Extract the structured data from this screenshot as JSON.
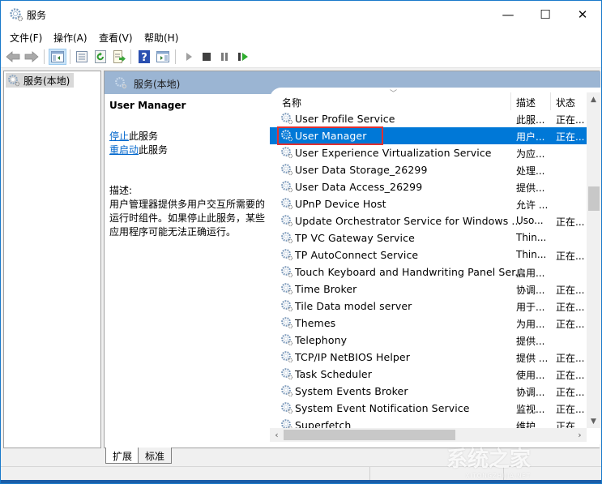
{
  "window": {
    "title": "服务",
    "controls": {
      "minimize": "—",
      "maximize": "☐",
      "close": "✕"
    }
  },
  "menu": [
    {
      "label": "文件(F)"
    },
    {
      "label": "操作(A)"
    },
    {
      "label": "查看(V)"
    },
    {
      "label": "帮助(H)"
    }
  ],
  "toolbar": {
    "buttons": [
      "back-icon",
      "forward-icon",
      "show-hide-console-tree-icon",
      "properties-icon",
      "refresh-icon",
      "export-list-icon",
      "help-icon",
      "show-action-pane-icon",
      "start-service-icon",
      "stop-service-icon",
      "pause-service-icon",
      "restart-service-icon"
    ]
  },
  "tree": {
    "items": [
      {
        "label": "服务(本地)",
        "selected": true
      }
    ]
  },
  "pane": {
    "header": "服务(本地)",
    "detail": {
      "service_name": "User Manager",
      "stop_link": "停止",
      "stop_suffix": "此服务",
      "restart_link": "重启动",
      "restart_suffix": "此服务",
      "desc_label": "描述:",
      "desc_text": "用户管理器提供多用户交互所需要的运行时组件。如果停止此服务，某些应用程序可能无法正确运行。"
    },
    "columns": {
      "name": "名称",
      "description": "描述",
      "status": "状态"
    },
    "services": [
      {
        "name": "User Profile Service",
        "description": "此服...",
        "status": "正在..."
      },
      {
        "name": "User Manager",
        "description": "用户...",
        "status": "正在...",
        "selected": true
      },
      {
        "name": "User Experience Virtualization Service",
        "description": "为应...",
        "status": ""
      },
      {
        "name": "User Data Storage_26299",
        "description": "处理...",
        "status": ""
      },
      {
        "name": "User Data Access_26299",
        "description": "提供...",
        "status": ""
      },
      {
        "name": "UPnP Device Host",
        "description": "允许 ...",
        "status": ""
      },
      {
        "name": "Update Orchestrator Service for Windows ...",
        "description": "Uso...",
        "status": "正在..."
      },
      {
        "name": "TP VC Gateway Service",
        "description": "Thin...",
        "status": ""
      },
      {
        "name": "TP AutoConnect Service",
        "description": "Thin...",
        "status": "正在..."
      },
      {
        "name": "Touch Keyboard and Handwriting Panel Ser...",
        "description": "启用...",
        "status": ""
      },
      {
        "name": "Time Broker",
        "description": "协调...",
        "status": "正在..."
      },
      {
        "name": "Tile Data model server",
        "description": "用于...",
        "status": "正在..."
      },
      {
        "name": "Themes",
        "description": "为用...",
        "status": "正在..."
      },
      {
        "name": "Telephony",
        "description": "提供...",
        "status": ""
      },
      {
        "name": "TCP/IP NetBIOS Helper",
        "description": "提供 ...",
        "status": "正在..."
      },
      {
        "name": "Task Scheduler",
        "description": "使用...",
        "status": "正在..."
      },
      {
        "name": "System Events Broker",
        "description": "协调...",
        "status": "正在..."
      },
      {
        "name": "System Event Notification Service",
        "description": "监视...",
        "status": "正在..."
      },
      {
        "name": "Superfetch",
        "description": "维护...",
        "status": "正在..."
      }
    ],
    "highlight_color": "#e03030",
    "selection_color": "#0078d7"
  },
  "tabs": [
    {
      "label": "扩展",
      "active": true
    },
    {
      "label": "标准",
      "active": false
    }
  ],
  "watermark": {
    "text": "系统之家",
    "subtext": "XITONGZHIJIA.NET"
  }
}
